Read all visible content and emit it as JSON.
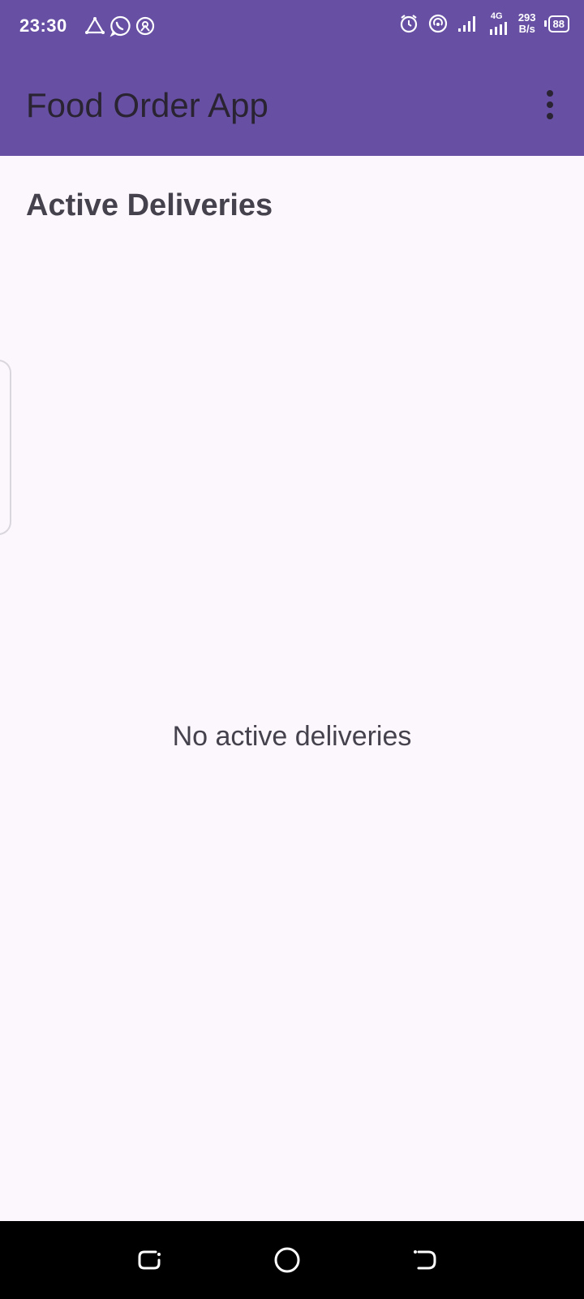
{
  "status_bar": {
    "time": "23:30",
    "network_type": "4G",
    "speed_value": "293",
    "speed_unit": "B/s",
    "battery": "88"
  },
  "app_bar": {
    "title": "Food Order App",
    "background": "#6750A4",
    "menu_icon": "more-vert-icon"
  },
  "main": {
    "section_title": "Active Deliveries",
    "empty_message": "No active deliveries"
  },
  "nav_bar": {
    "icons": [
      "recents-icon",
      "home-icon",
      "back-icon"
    ]
  }
}
